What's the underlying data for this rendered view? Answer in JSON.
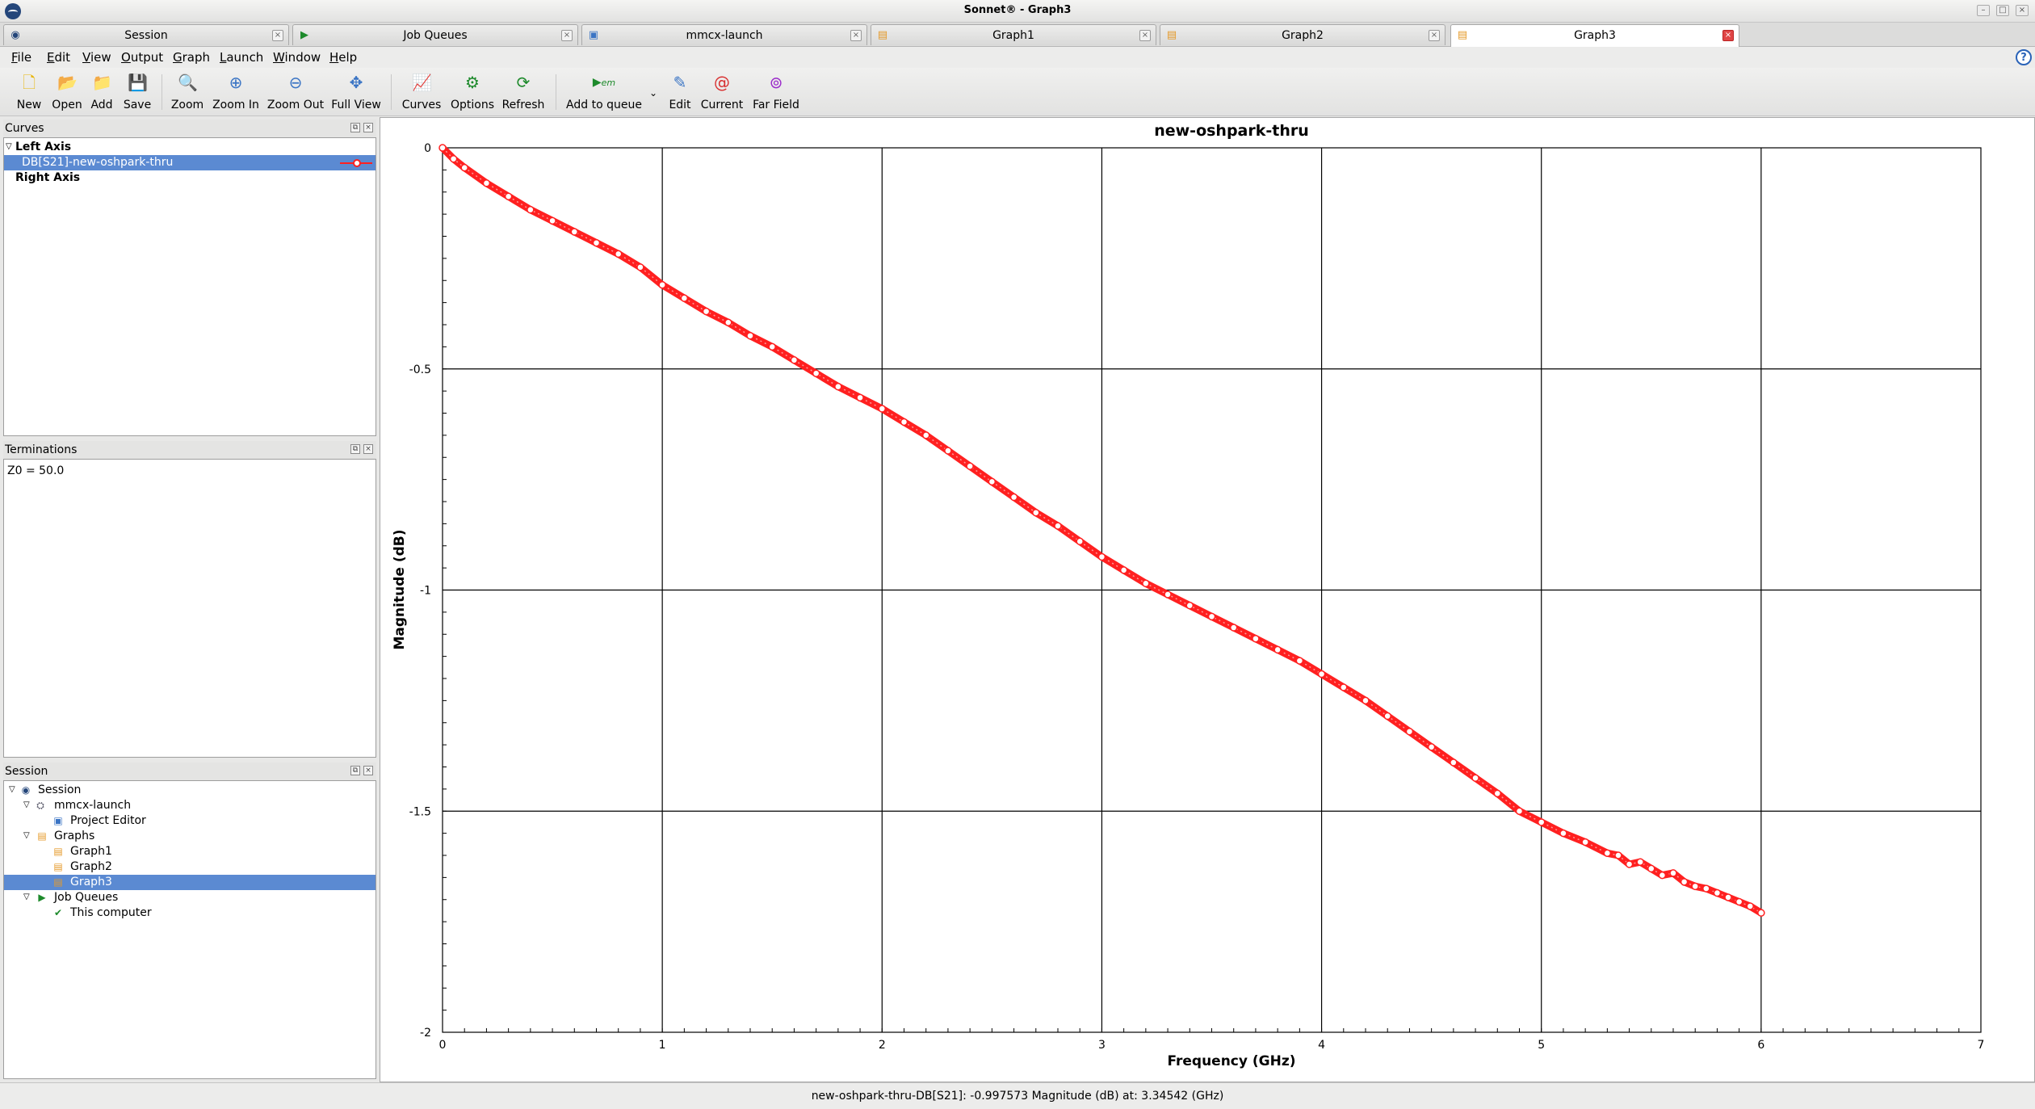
{
  "window": {
    "title": "Sonnet® - Graph3"
  },
  "tabs": [
    {
      "label": "Session",
      "icon": "session-icon",
      "active": false
    },
    {
      "label": "Job Queues",
      "icon": "job-queue-icon",
      "active": false
    },
    {
      "label": "mmcx-launch",
      "icon": "project-icon",
      "active": false
    },
    {
      "label": "Graph1",
      "icon": "graph-icon",
      "active": false
    },
    {
      "label": "Graph2",
      "icon": "graph-icon",
      "active": false
    },
    {
      "label": "Graph3",
      "icon": "graph-icon",
      "active": true
    }
  ],
  "menu": [
    "File",
    "Edit",
    "View",
    "Output",
    "Graph",
    "Launch",
    "Window",
    "Help"
  ],
  "toolbar": {
    "new": "New",
    "open": "Open",
    "add": "Add",
    "save": "Save",
    "zoom": "Zoom",
    "zoom_in": "Zoom In",
    "zoom_out": "Zoom Out",
    "full_view": "Full View",
    "curves": "Curves",
    "options": "Options",
    "refresh": "Refresh",
    "add_to_queue": "Add to queue",
    "em_label": "em",
    "edit": "Edit",
    "current": "Current",
    "far_field": "Far Field"
  },
  "curves_panel": {
    "title": "Curves",
    "left_axis": "Left Axis",
    "curve": "DB[S21]-new-oshpark-thru",
    "right_axis": "Right Axis"
  },
  "terminations_panel": {
    "title": "Terminations",
    "value": "Z0 = 50.0"
  },
  "session_panel": {
    "title": "Session",
    "root": "Session",
    "project": "mmcx-launch",
    "project_editor": "Project Editor",
    "graphs": "Graphs",
    "graph1": "Graph1",
    "graph2": "Graph2",
    "graph3": "Graph3",
    "job_queues": "Job Queues",
    "this_computer": "This computer"
  },
  "chart_data": {
    "type": "line",
    "title": "new-oshpark-thru",
    "xlabel": "Frequency (GHz)",
    "ylabel": "Magnitude (dB)",
    "xlim": [
      0,
      7
    ],
    "ylim": [
      -2,
      0
    ],
    "xticks": [
      0,
      1,
      2,
      3,
      4,
      5,
      6,
      7
    ],
    "yticks": [
      0,
      -0.5,
      -1,
      -1.5,
      -2
    ],
    "ytick_labels": [
      "0",
      "-0.5",
      "-1",
      "-1.5",
      "-2"
    ],
    "grid": true,
    "series": [
      {
        "name": "DB[S21]-new-oshpark-thru",
        "color": "#ff2020",
        "marker": "circle",
        "x": [
          0,
          0.05,
          0.1,
          0.2,
          0.3,
          0.4,
          0.5,
          0.6,
          0.7,
          0.8,
          0.9,
          1.0,
          1.1,
          1.2,
          1.3,
          1.4,
          1.5,
          1.6,
          1.7,
          1.8,
          1.9,
          2.0,
          2.1,
          2.2,
          2.3,
          2.4,
          2.5,
          2.6,
          2.7,
          2.8,
          2.9,
          3.0,
          3.1,
          3.2,
          3.3,
          3.4,
          3.5,
          3.6,
          3.7,
          3.8,
          3.9,
          4.0,
          4.1,
          4.2,
          4.3,
          4.4,
          4.5,
          4.6,
          4.7,
          4.8,
          4.9,
          5.0,
          5.1,
          5.2,
          5.3,
          5.35,
          5.4,
          5.45,
          5.5,
          5.55,
          5.6,
          5.65,
          5.7,
          5.75,
          5.8,
          5.85,
          5.9,
          5.95,
          6.0
        ],
        "y": [
          0,
          -0.025,
          -0.045,
          -0.08,
          -0.11,
          -0.14,
          -0.165,
          -0.19,
          -0.215,
          -0.24,
          -0.27,
          -0.31,
          -0.34,
          -0.37,
          -0.395,
          -0.425,
          -0.45,
          -0.48,
          -0.51,
          -0.54,
          -0.565,
          -0.59,
          -0.62,
          -0.65,
          -0.685,
          -0.72,
          -0.755,
          -0.79,
          -0.825,
          -0.855,
          -0.89,
          -0.925,
          -0.955,
          -0.985,
          -1.01,
          -1.035,
          -1.06,
          -1.085,
          -1.11,
          -1.135,
          -1.16,
          -1.19,
          -1.22,
          -1.25,
          -1.285,
          -1.32,
          -1.355,
          -1.39,
          -1.425,
          -1.46,
          -1.5,
          -1.525,
          -1.55,
          -1.57,
          -1.595,
          -1.6,
          -1.62,
          -1.615,
          -1.63,
          -1.645,
          -1.64,
          -1.66,
          -1.67,
          -1.675,
          -1.685,
          -1.695,
          -1.705,
          -1.715,
          -1.73
        ]
      }
    ]
  },
  "status": {
    "text": "new-oshpark-thru-DB[S21]: -0.997573 Magnitude (dB) at: 3.34542 (GHz)"
  }
}
